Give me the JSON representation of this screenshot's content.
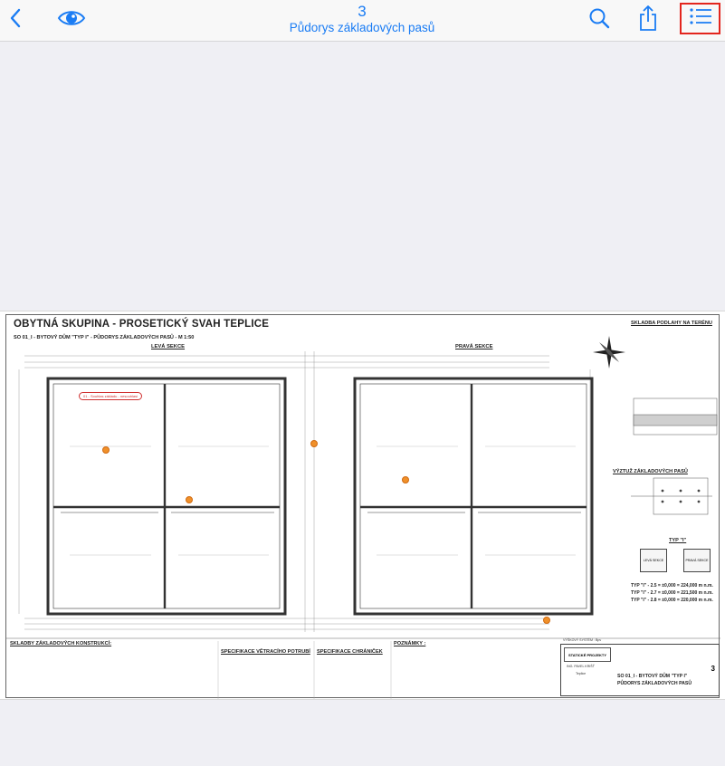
{
  "nav": {
    "page_number": "3",
    "document_title": "Půdorys základových pasů"
  },
  "icons": {
    "back": "chevron-left-icon",
    "eye": "eye-icon",
    "search": "search-icon",
    "share": "share-icon",
    "list": "list-icon"
  },
  "colors": {
    "accent": "#1a7cf4",
    "highlight_border": "#e3251d",
    "annotation_pin": "#f0902a"
  },
  "drawing": {
    "title": "OBYTNÁ SKUPINA - PROSETICKÝ SVAH TEPLICE",
    "subtitle": "SO 01_I - BYTOVÝ DŮM \"TYP I\" - PŮDORYS ZÁKLADOVÝCH PASŮ - M 1:50",
    "left_section": "LEVÁ SEKCE",
    "right_section": "PRAVÁ SEKCE",
    "floor_layers_title": "SKLADBA PODLAHY NA TERÉNU",
    "reinforcement_title": "VÝZTUŽ ZÁKLADOVÝCH PASŮ",
    "type_label": "TYP \"I\"",
    "type_left": "LEVÁ SEKCE",
    "type_right": "PRAVÁ SEKCE",
    "type_lines": [
      "TYP \"I\" - 2.5 = ±0,000 = 224,000 m n.m.",
      "TYP \"I\" - 2.7 = ±0,000 = 221,500 m n.m.",
      "TYP \"I\" - 2.8 = ±0,000 = 220,000 m n.m."
    ],
    "foundations_title": "SKLADBY ZÁKLADOVÝCH KONSTRUKCÍ:",
    "vent_title": "SPECIFIKACE VĚTRACÍHO POTRUBÍ",
    "protector_title": "SPECIFIKACE CHRÁNIČEK",
    "notes_title": "POZNÁMKY :",
    "height_system": "VÝŠKOVÝ SYSTÉM : Bpv",
    "annotation_text": "01 - Souhlas základu - nesouhlasí",
    "title_block": {
      "firm": "STATICKÉ PROJEKTY",
      "engineer": "ING. PAVEL KRIŠŤ",
      "city": "Teplice",
      "project_line": "SO 01_I - BYTOVÝ DŮM \"TYP I\"",
      "drawing_name": "PŮDORYS ZÁKLADOVÝCH PASŮ",
      "sheet_number": "3"
    }
  }
}
